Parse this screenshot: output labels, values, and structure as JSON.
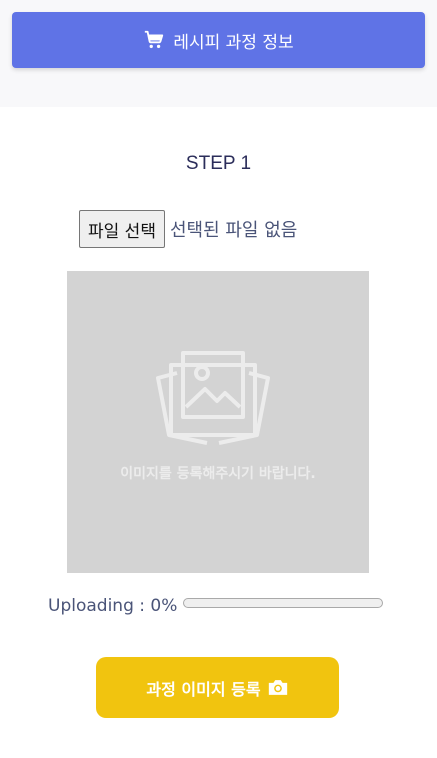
{
  "header": {
    "title": "레시피 과정 정보",
    "icon": "cart-icon",
    "color": "#5f73e6"
  },
  "step": {
    "title": "STEP 1"
  },
  "file_input": {
    "button_label": "파일 선택",
    "status": "선택된 파일 없음"
  },
  "image_placeholder": {
    "icon": "photo-stack-icon",
    "text": "이미지를 등록해주시기 바랍니다."
  },
  "upload": {
    "label": "Uploading : 0%",
    "progress": 0
  },
  "register_button": {
    "label": "과정 이미지 등록",
    "icon": "camera-icon",
    "color": "#f1c40f"
  }
}
